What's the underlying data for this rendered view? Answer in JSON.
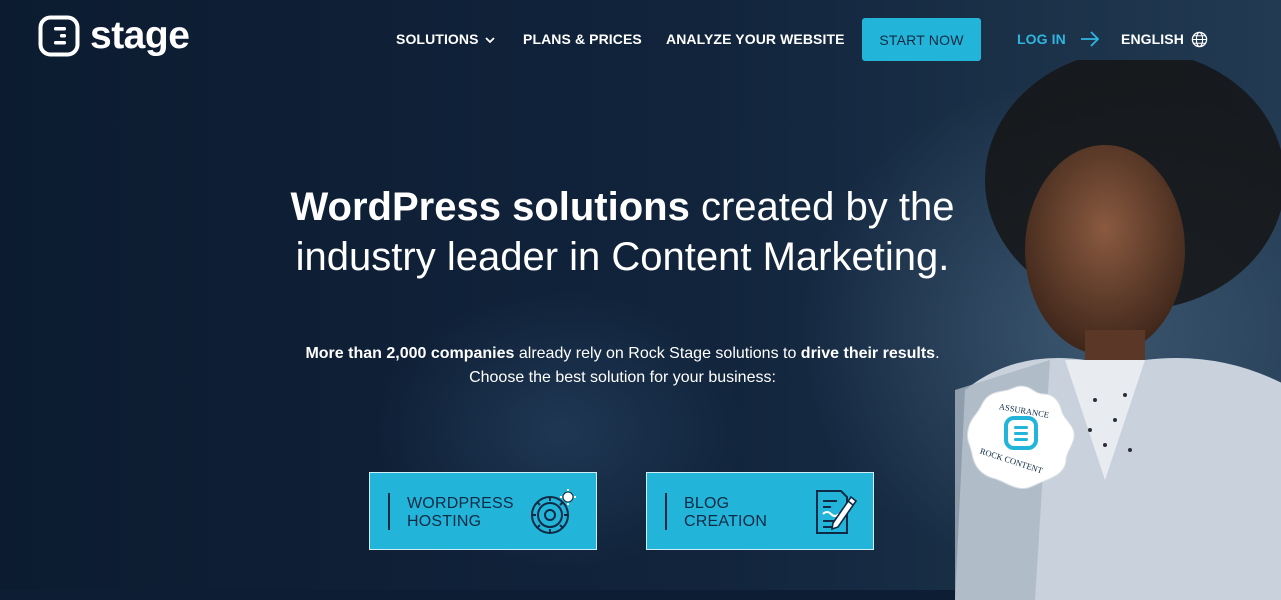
{
  "brand": {
    "name": "stage"
  },
  "nav": {
    "items": [
      {
        "label": "SOLUTIONS"
      },
      {
        "label": "PLANS & PRICES"
      },
      {
        "label": "ANALYZE YOUR WEBSITE"
      }
    ],
    "cta_label": "START NOW",
    "login_label": "LOG IN",
    "language_label": "ENGLISH"
  },
  "hero": {
    "headline_bold": "WordPress solutions",
    "headline_rest_1": " created by the",
    "headline_line_2": "industry leader in Content Marketing.",
    "sub_bold_1": "More than 2,000 companies",
    "sub_text_1": " already rely on Rock Stage solutions to ",
    "sub_bold_2": "drive their results",
    "sub_text_2": ".",
    "sub_line_2": "Choose the best solution for your business:"
  },
  "cards": [
    {
      "line1": "WORDPRESS",
      "line2": "HOSTING",
      "icon": "gear-hosting-icon"
    },
    {
      "line1": "BLOG",
      "line2": "CREATION",
      "icon": "document-pencil-icon"
    }
  ],
  "badge": {
    "top_text": "ASSURANCE",
    "bottom_text": "ROCK CONTENT"
  },
  "colors": {
    "accent": "#22b4d9",
    "background": "#0d1d33",
    "card_text": "#0e2a44",
    "login": "#2fb6e0"
  }
}
